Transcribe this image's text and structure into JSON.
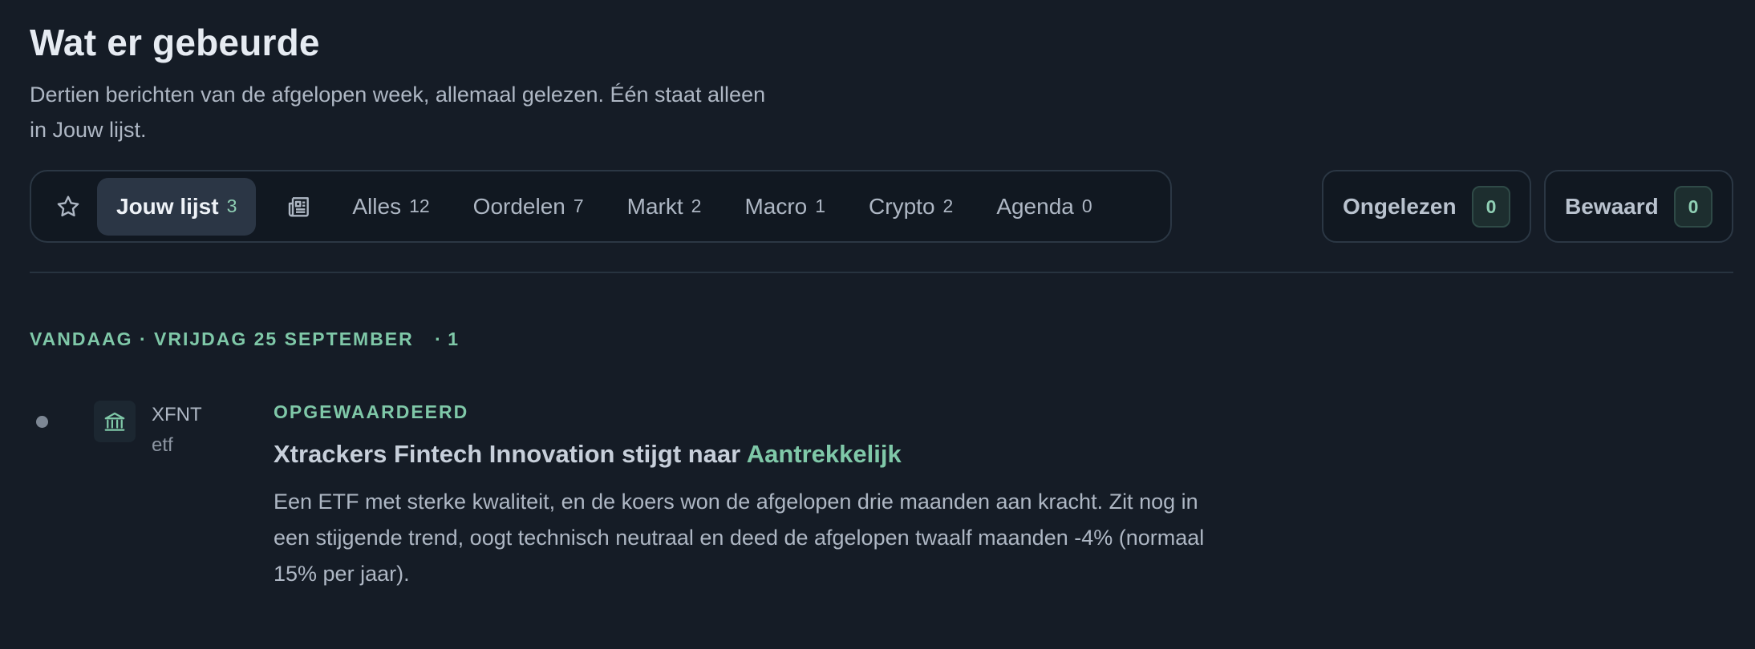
{
  "header": {
    "title": "Wat er gebeurde",
    "subtitle": "Dertien berichten van de afgelopen week, allemaal gelezen. Één staat alleen in Jouw lijst."
  },
  "filters": {
    "star_icon": "star-icon",
    "news_icon": "newspaper-icon",
    "tabs": [
      {
        "label": "Jouw lijst",
        "count": "3",
        "active": true
      },
      {
        "label": "Alles",
        "count": "12"
      },
      {
        "label": "Oordelen",
        "count": "7"
      },
      {
        "label": "Markt",
        "count": "2"
      },
      {
        "label": "Macro",
        "count": "1"
      },
      {
        "label": "Crypto",
        "count": "2"
      },
      {
        "label": "Agenda",
        "count": "0"
      }
    ]
  },
  "side_buttons": {
    "unread": {
      "label": "Ongelezen",
      "count": "0"
    },
    "saved": {
      "label": "Bewaard",
      "count": "0"
    }
  },
  "feed": {
    "day_label": "VANDAAG · VRIJDAG 25 SEPTEMBER",
    "day_count": "· 1",
    "items": [
      {
        "icon": "bank-icon",
        "ticker": "XFNT",
        "type": "etf",
        "kicker": "OPGEWAARDEERD",
        "headline_main": "Xtrackers Fintech Innovation stijgt naar",
        "headline_accent": "Aantrekkelijk",
        "body": "Een ETF met sterke kwaliteit, en de koers won de afgelopen drie maanden aan kracht. Zit nog in een stijgende trend, oogt technisch neutraal en deed de afgelopen twaalf maanden -4% (normaal 15% per jaar)."
      }
    ]
  },
  "colors": {
    "background": "#151c26",
    "accent": "#7fc8a8",
    "active_tab": "#2b3645"
  }
}
